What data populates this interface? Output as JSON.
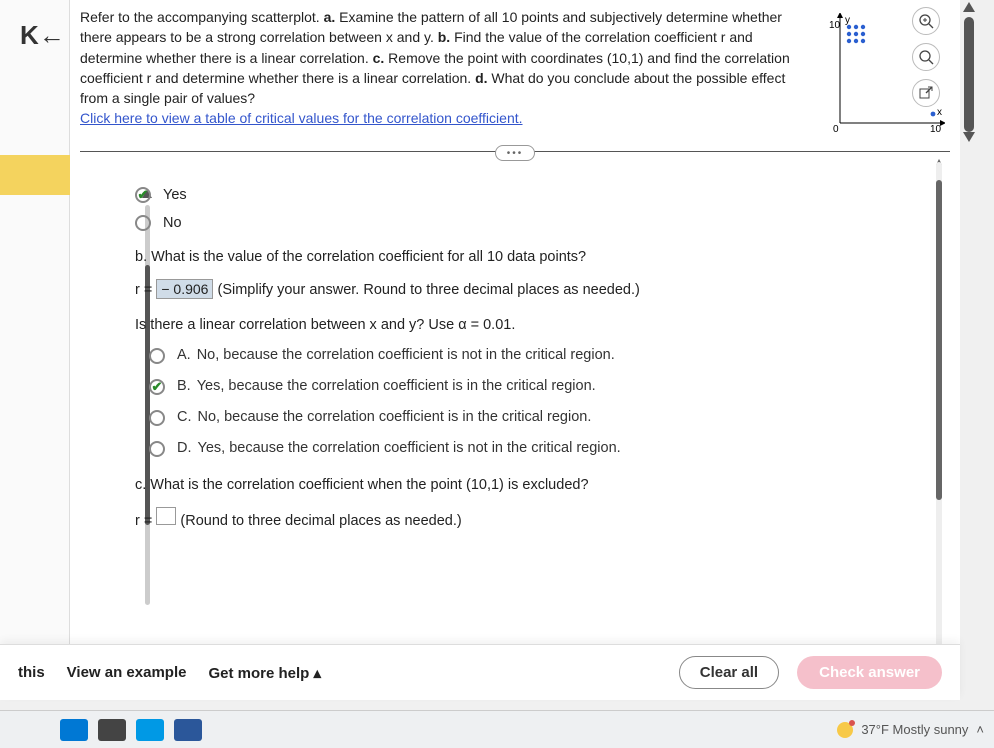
{
  "header": {
    "prompt_prefix": "Refer to the accompanying scatterplot. ",
    "part_a_label": "a.",
    "part_a": " Examine the pattern of all 10 points and subjectively determine whether there appears to be a strong correlation between x and y. ",
    "part_b_label": "b.",
    "part_b": " Find the value of the correlation coefficient r and determine whether there is a linear correlation. ",
    "part_c_label": "c.",
    "part_c": " Remove the point with coordinates (10,1) and find the correlation coefficient r and determine whether there is a linear correlation. ",
    "part_d_label": "d.",
    "part_d": " What do you conclude about the possible effect from a single pair of values?",
    "link": "Click here to view a table of critical values for the correlation coefficient."
  },
  "scatter": {
    "y_label": "y",
    "x_label": "x",
    "y_max": "10",
    "origin": "0",
    "x_max": "10"
  },
  "icons": {
    "zoom_in": "⊕",
    "zoom_text": "🔍",
    "popout": "↗"
  },
  "yes_no": {
    "yes": "Yes",
    "no": "No"
  },
  "part_b": {
    "question": "b. What is the value of the correlation coefficient for all 10 data points?",
    "r_prefix": "r = ",
    "r_value": "− 0.906",
    "r_hint": " (Simplify your answer. Round to three decimal places as needed.)",
    "linear_q": "Is there a linear correlation between x and y? Use α = 0.01."
  },
  "mc": {
    "a_label": "A.",
    "a": "No, because the correlation coefficient is not in the critical region.",
    "b_label": "B.",
    "b": "Yes, because the correlation coefficient is in the critical region.",
    "c_label": "C.",
    "c": "No, because the correlation coefficient is in the critical region.",
    "d_label": "D.",
    "d": "Yes, because the correlation coefficient is not in the critical region."
  },
  "part_c": {
    "question": "c. What is the correlation coefficient when the point (10,1) is excluded?",
    "r_prefix": "r = ",
    "r_hint": " (Round to three decimal places as needed.)"
  },
  "footer": {
    "this": "this",
    "view_example": "View an example",
    "get_help": "Get more help ▴",
    "clear": "Clear all",
    "check": "Check answer"
  },
  "taskbar": {
    "weather": "37°F Mostly sunny"
  },
  "chart_data": {
    "type": "scatter",
    "title": "",
    "xlabel": "x",
    "ylabel": "y",
    "xlim": [
      0,
      10
    ],
    "ylim": [
      0,
      10
    ],
    "series": [
      {
        "name": "points",
        "x": [
          1,
          1,
          1,
          2,
          2,
          2,
          3,
          3,
          3,
          10
        ],
        "y": [
          8,
          9,
          10,
          8,
          9,
          10,
          8,
          9,
          10,
          1
        ]
      }
    ]
  }
}
